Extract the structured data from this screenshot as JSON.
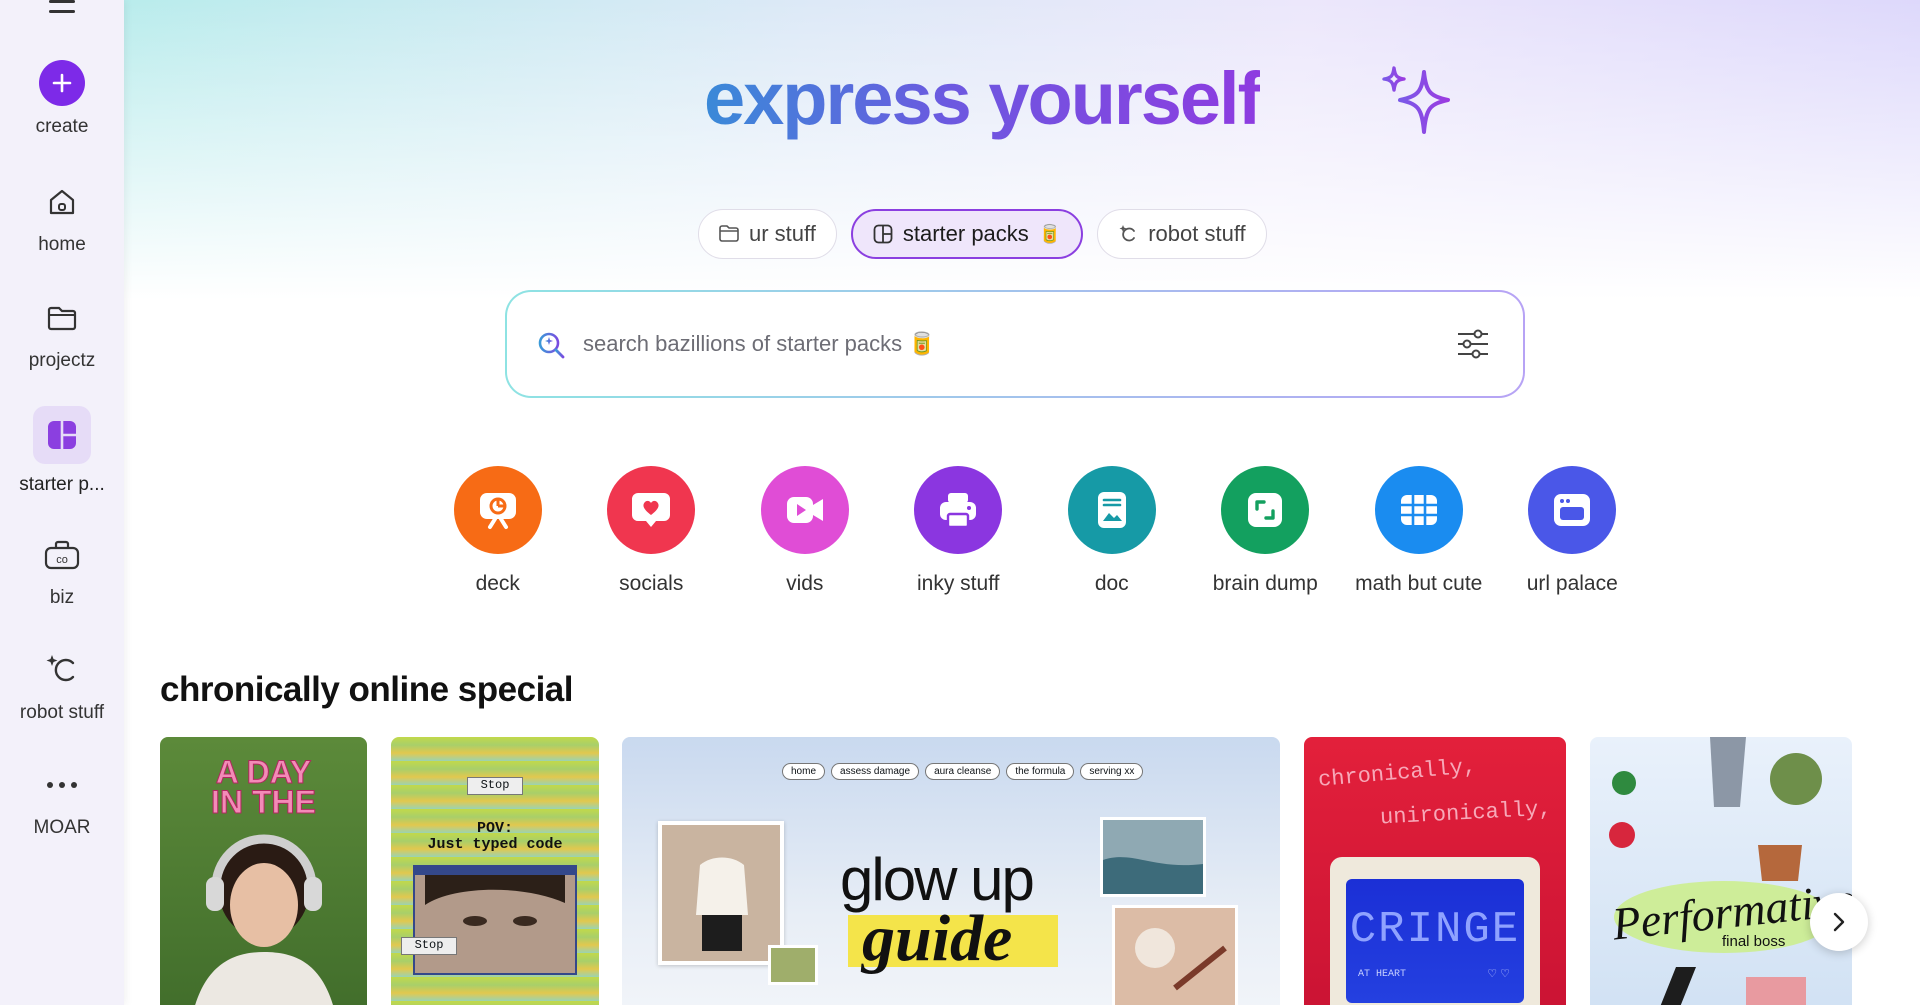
{
  "sidebar": {
    "items": [
      {
        "label": "create",
        "icon": "plus-icon"
      },
      {
        "label": "home",
        "icon": "home-icon"
      },
      {
        "label": "projectz",
        "icon": "folder-icon"
      },
      {
        "label": "starter p...",
        "icon": "starter-packs-icon"
      },
      {
        "label": "biz",
        "icon": "briefcase-icon"
      },
      {
        "label": "robot stuff",
        "icon": "magic-icon"
      },
      {
        "label": "MOAR",
        "icon": "more-icon"
      }
    ]
  },
  "hero": {
    "title": "express yourself"
  },
  "tabs": [
    {
      "label": "ur stuff",
      "icon": "folder-icon"
    },
    {
      "label": "starter packs",
      "icon": "template-icon",
      "emoji": "🥫"
    },
    {
      "label": "robot stuff",
      "icon": "magic-icon"
    }
  ],
  "search": {
    "placeholder": "search bazillions of starter packs 🥫"
  },
  "categories": [
    {
      "label": "deck",
      "color": "#f76b15"
    },
    {
      "label": "socials",
      "color": "#f0364f"
    },
    {
      "label": "vids",
      "color": "#e04dd6"
    },
    {
      "label": "inky stuff",
      "color": "#8b36e0"
    },
    {
      "label": "doc",
      "color": "#169aa6"
    },
    {
      "label": "brain dump",
      "color": "#13a05f"
    },
    {
      "label": "math but cute",
      "color": "#1a8cf0"
    },
    {
      "label": "url palace",
      "color": "#4a57e8"
    }
  ],
  "section": {
    "title": "chronically online special"
  },
  "cards": {
    "c1": {
      "line1": "A DAY",
      "line2": "IN THE"
    },
    "c2": {
      "stop1": "Stop",
      "pov": "POV:",
      "typed": "Just typed code",
      "stop2": "Stop"
    },
    "c3": {
      "pills": [
        "home",
        "assess damage",
        "aura cleanse",
        "the formula",
        "serving xx"
      ],
      "line1": "glow up",
      "line2": "guide"
    },
    "c4": {
      "line1": "chronically,",
      "line2": "unironically,",
      "screen": "CRINGE",
      "sub": "AT HEART",
      "hearts": "♡ ♡"
    },
    "c5": {
      "script": "Performative",
      "sub": "final boss"
    }
  }
}
